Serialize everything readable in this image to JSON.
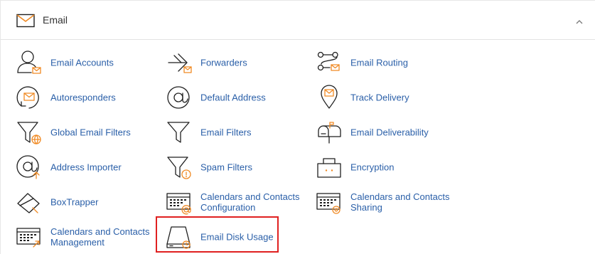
{
  "section": {
    "title": "Email",
    "title_icon": "envelope-icon",
    "collapse_icon": "chevron-up-icon"
  },
  "items": [
    {
      "label": "Email Accounts",
      "icon": "email-accounts-icon"
    },
    {
      "label": "Forwarders",
      "icon": "forwarders-icon"
    },
    {
      "label": "Email Routing",
      "icon": "email-routing-icon"
    },
    {
      "label": "Autoresponders",
      "icon": "autoresponders-icon"
    },
    {
      "label": "Default Address",
      "icon": "default-address-icon"
    },
    {
      "label": "Track Delivery",
      "icon": "track-delivery-icon"
    },
    {
      "label": "Global Email Filters",
      "icon": "global-filter-icon"
    },
    {
      "label": "Email Filters",
      "icon": "email-filter-icon"
    },
    {
      "label": "Email Deliverability",
      "icon": "mailbox-icon"
    },
    {
      "label": "Address Importer",
      "icon": "address-importer-icon"
    },
    {
      "label": "Spam Filters",
      "icon": "spam-filter-icon"
    },
    {
      "label": "Encryption",
      "icon": "encryption-icon"
    },
    {
      "label": "BoxTrapper",
      "icon": "boxtrapper-icon"
    },
    {
      "label": "Calendars and Contacts Configuration",
      "icon": "calendar-config-icon"
    },
    {
      "label": "Calendars and Contacts Sharing",
      "icon": "calendar-sharing-icon"
    },
    {
      "label": "Calendars and Contacts Management",
      "icon": "calendar-management-icon"
    },
    {
      "label": "Email Disk Usage",
      "icon": "disk-usage-icon"
    }
  ],
  "highlighted_item": "Email Disk Usage",
  "colors": {
    "link": "#2a5fa8",
    "accent": "#f08a24",
    "highlight_border": "#e02020"
  }
}
